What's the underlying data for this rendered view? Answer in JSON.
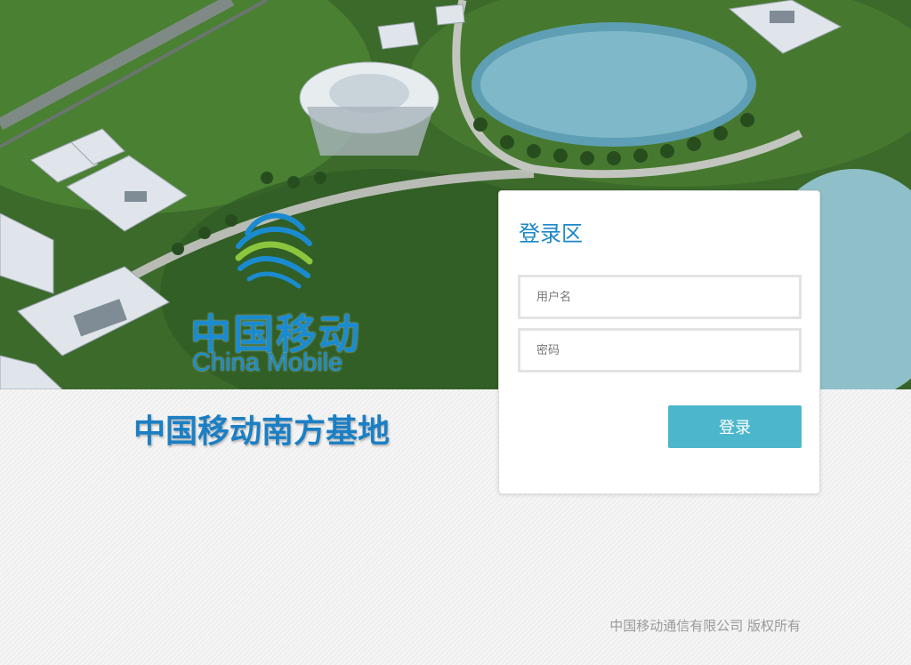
{
  "brand": {
    "logo_cn": "中国移动",
    "logo_en": "China Mobile",
    "site_title": "中国移动南方基地"
  },
  "login": {
    "title": "登录区",
    "username_placeholder": "用户名",
    "password_placeholder": "密码",
    "submit_label": "登录"
  },
  "footer": {
    "copyright": "中国移动通信有限公司 版权所有"
  },
  "colors": {
    "brand_blue": "#1a88c9",
    "button": "#4cb7cc",
    "logo_green": "#8cc63f"
  },
  "icons": {
    "logo": "china-mobile-logo-icon"
  }
}
